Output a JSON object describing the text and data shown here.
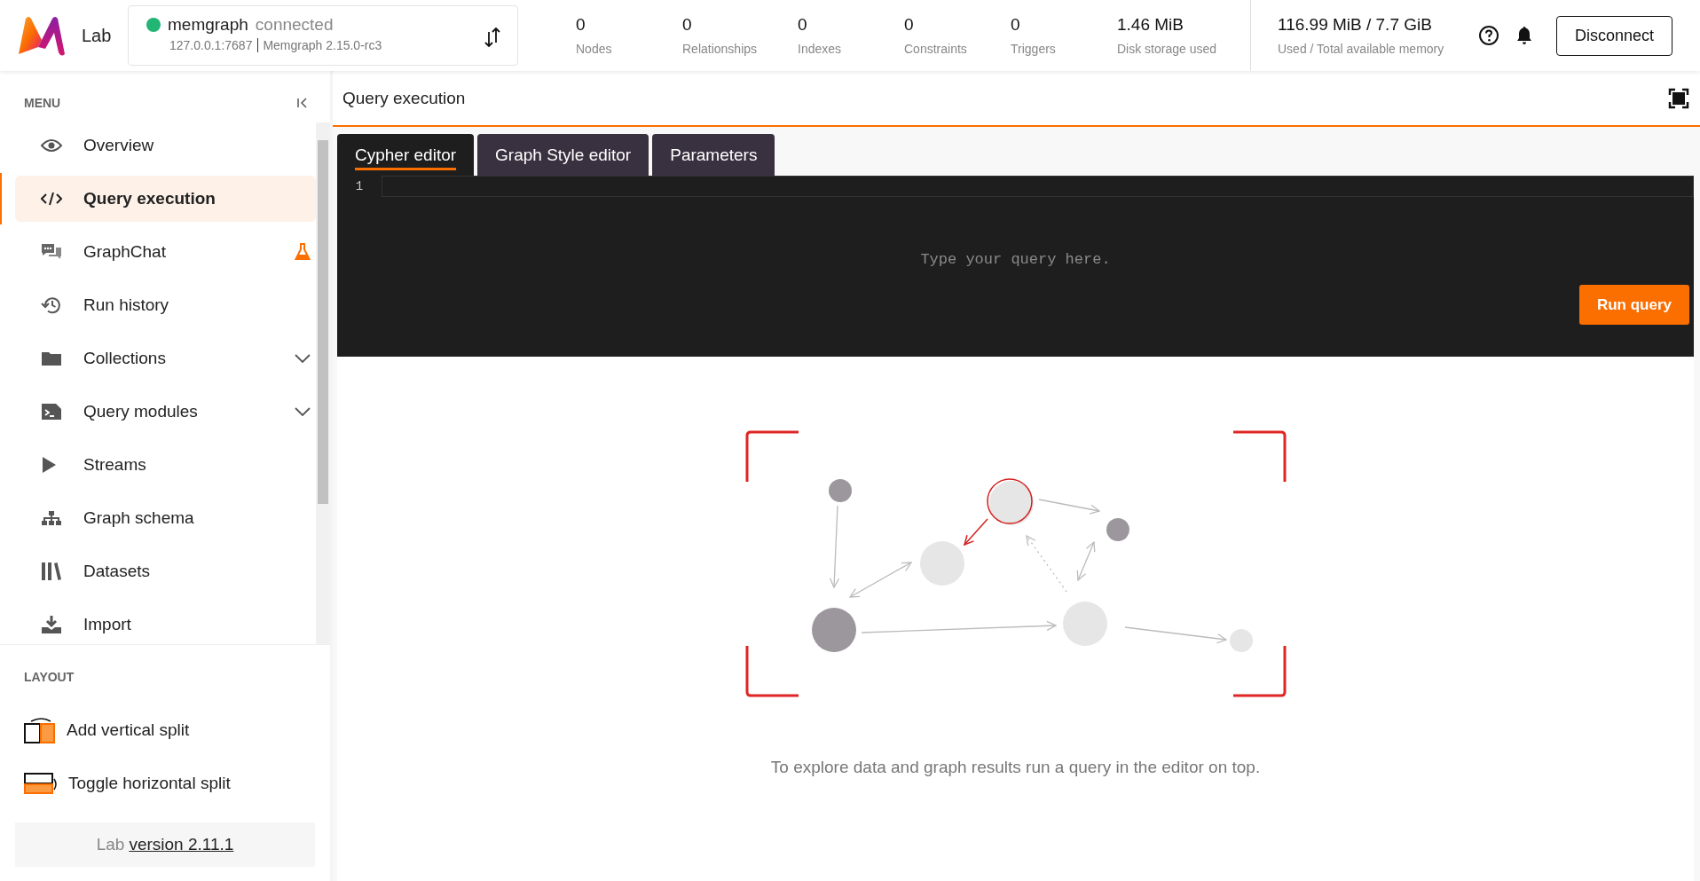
{
  "header": {
    "logo_text": "Lab",
    "connection": {
      "name": "memgraph",
      "status": "connected",
      "online": true,
      "address": "127.0.0.1:7687",
      "version": "Memgraph 2.15.0-rc3"
    },
    "stats": [
      {
        "value": "0",
        "label": "Nodes"
      },
      {
        "value": "0",
        "label": "Relationships"
      },
      {
        "value": "0",
        "label": "Indexes"
      },
      {
        "value": "0",
        "label": "Constraints"
      },
      {
        "value": "0",
        "label": "Triggers"
      },
      {
        "value": "1.46 MiB",
        "label": "Disk storage used"
      }
    ],
    "memory": {
      "value": "116.99 MiB / 7.7 GiB",
      "label": "Used / Total available memory"
    },
    "disconnect_button": "Disconnect"
  },
  "sidebar": {
    "menu_heading": "MENU",
    "items": [
      {
        "label": "Overview",
        "selected": false,
        "expandable": false,
        "beta": false
      },
      {
        "label": "Query execution",
        "selected": true,
        "expandable": false,
        "beta": false
      },
      {
        "label": "GraphChat",
        "selected": false,
        "expandable": false,
        "beta": true
      },
      {
        "label": "Run history",
        "selected": false,
        "expandable": false,
        "beta": false
      },
      {
        "label": "Collections",
        "selected": false,
        "expandable": true,
        "beta": false
      },
      {
        "label": "Query modules",
        "selected": false,
        "expandable": true,
        "beta": false
      },
      {
        "label": "Streams",
        "selected": false,
        "expandable": false,
        "beta": false
      },
      {
        "label": "Graph schema",
        "selected": false,
        "expandable": false,
        "beta": false
      },
      {
        "label": "Datasets",
        "selected": false,
        "expandable": false,
        "beta": false
      },
      {
        "label": "Import",
        "selected": false,
        "expandable": false,
        "beta": false
      }
    ],
    "layout_heading": "LAYOUT",
    "layout_items": [
      "Add vertical split",
      "Toggle horizontal split"
    ],
    "version_prefix": "Lab",
    "version_link": "version 2.11.1"
  },
  "main": {
    "title": "Query execution",
    "tabs": [
      {
        "label": "Cypher editor",
        "selected": true
      },
      {
        "label": "Graph Style editor",
        "selected": false
      },
      {
        "label": "Parameters",
        "selected": false
      }
    ],
    "editor": {
      "line_number": "1",
      "placeholder": "Type your query here."
    },
    "run_button": "Run query",
    "empty_message": "To explore data and graph results run a query in the editor on top."
  }
}
